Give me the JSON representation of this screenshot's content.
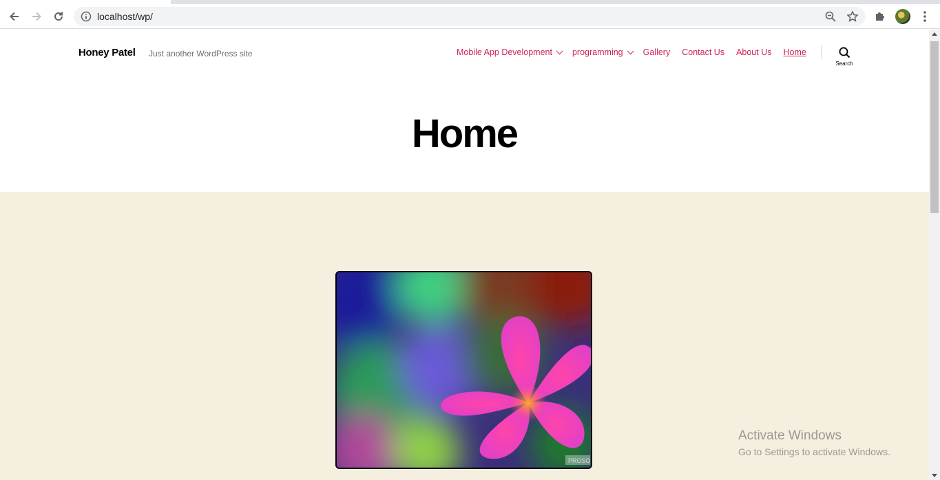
{
  "browser": {
    "url": "localhost/wp/"
  },
  "site": {
    "title": "Honey Patel",
    "description": "Just another WordPress site",
    "accent_color": "#cd2653",
    "content_bg_color": "#f5efe0"
  },
  "menu": {
    "items": [
      {
        "label": "Mobile App Development",
        "has_submenu": true
      },
      {
        "label": "programming",
        "has_submenu": true
      },
      {
        "label": "Gallery",
        "has_submenu": false
      },
      {
        "label": "Contact Us",
        "has_submenu": false
      },
      {
        "label": "About Us",
        "has_submenu": false
      },
      {
        "label": "Home",
        "has_submenu": false,
        "current": true
      }
    ],
    "search_label": "Search"
  },
  "page": {
    "title": "Home",
    "image_watermark": "PROSO"
  },
  "os_watermark": {
    "line1": "Activate Windows",
    "line2": "Go to Settings to activate Windows."
  }
}
